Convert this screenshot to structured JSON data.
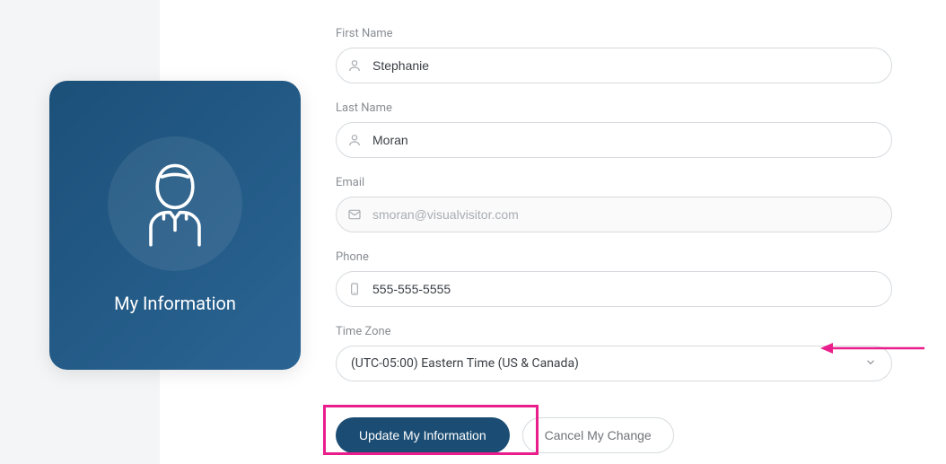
{
  "sidebar": {
    "title": "My Information"
  },
  "form": {
    "first_name": {
      "label": "First Name",
      "value": "Stephanie"
    },
    "last_name": {
      "label": "Last Name",
      "value": "Moran"
    },
    "email": {
      "label": "Email",
      "value": "smoran@visualvisitor.com"
    },
    "phone": {
      "label": "Phone",
      "value": "555-555-5555"
    },
    "timezone": {
      "label": "Time Zone",
      "selected": "(UTC-05:00) Eastern Time (US & Canada)"
    }
  },
  "buttons": {
    "update": "Update My Information",
    "cancel": "Cancel My Change"
  }
}
